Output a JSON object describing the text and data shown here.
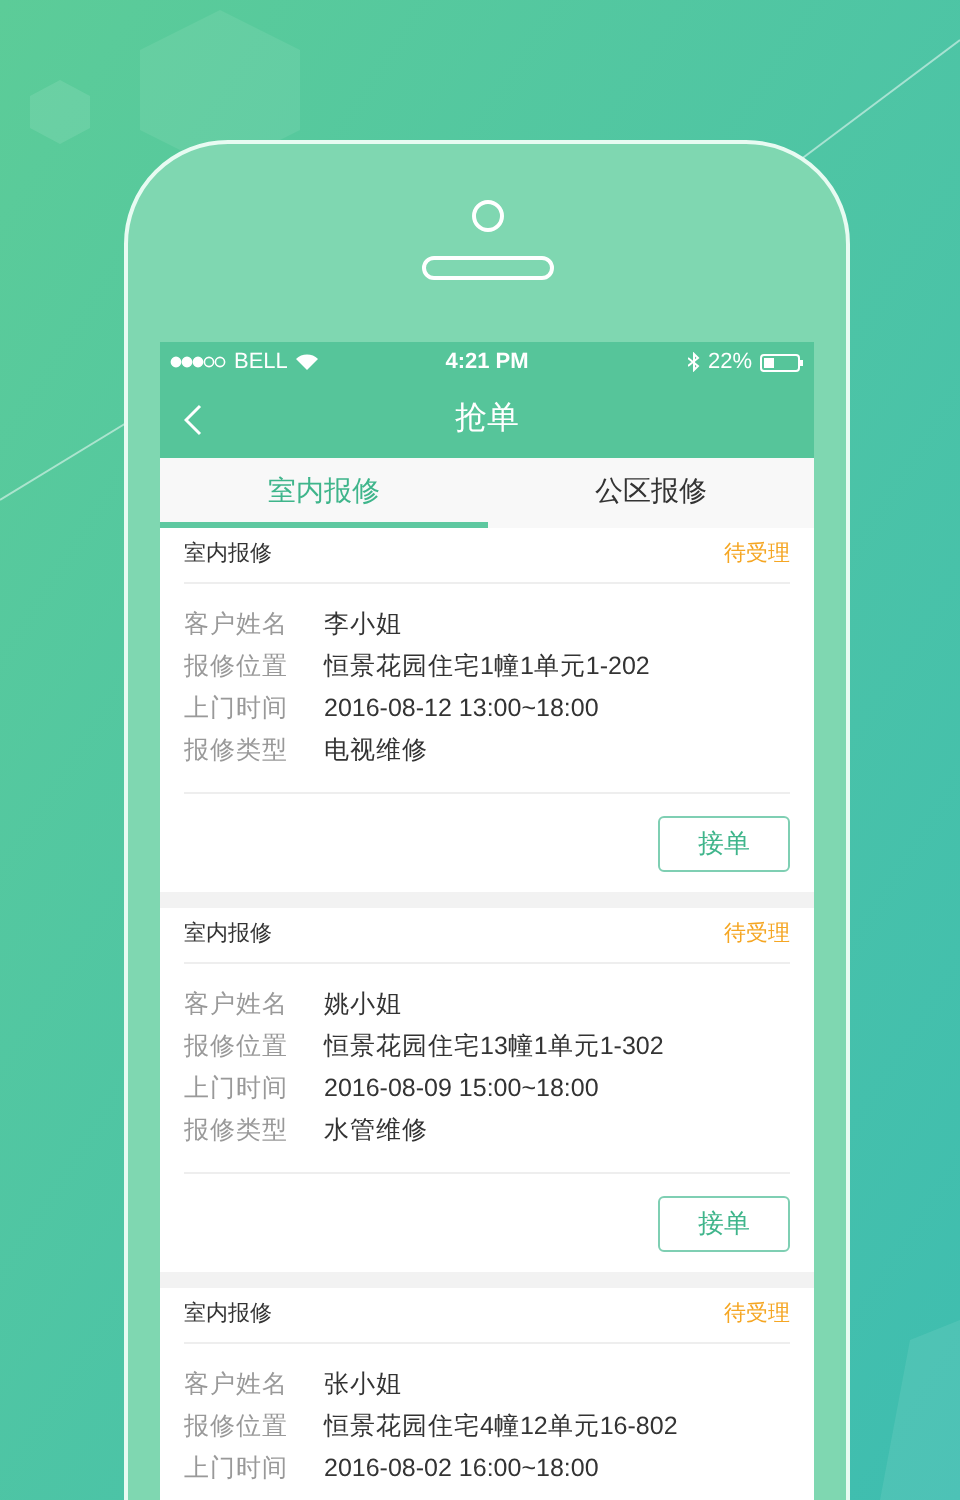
{
  "status_bar": {
    "carrier": "BELL",
    "time": "4:21 PM",
    "battery": "22%"
  },
  "nav": {
    "title": "抢单"
  },
  "tabs": [
    {
      "label": "室内报修",
      "selected": true
    },
    {
      "label": "公区报修",
      "selected": false
    }
  ],
  "orders": [
    {
      "category": "室内报修",
      "status": "待受理",
      "fields": [
        {
          "label": "客户姓名",
          "value": "李小姐"
        },
        {
          "label": "报修位置",
          "value": "恒景花园住宅1幢1单元1-202"
        },
        {
          "label": "上门时间",
          "value": "2016-08-12 13:00~18:00"
        },
        {
          "label": "报修类型",
          "value": "电视维修"
        }
      ],
      "action": "接单"
    },
    {
      "category": "室内报修",
      "status": "待受理",
      "fields": [
        {
          "label": "客户姓名",
          "value": "姚小姐"
        },
        {
          "label": "报修位置",
          "value": "恒景花园住宅13幢1单元1-302"
        },
        {
          "label": "上门时间",
          "value": "2016-08-09 15:00~18:00"
        },
        {
          "label": "报修类型",
          "value": "水管维修"
        }
      ],
      "action": "接单"
    },
    {
      "category": "室内报修",
      "status": "待受理",
      "fields": [
        {
          "label": "客户姓名",
          "value": "张小姐"
        },
        {
          "label": "报修位置",
          "value": "恒景花园住宅4幢12单元16-802"
        },
        {
          "label": "上门时间",
          "value": "2016-08-02 16:00~18:00"
        }
      ]
    }
  ]
}
